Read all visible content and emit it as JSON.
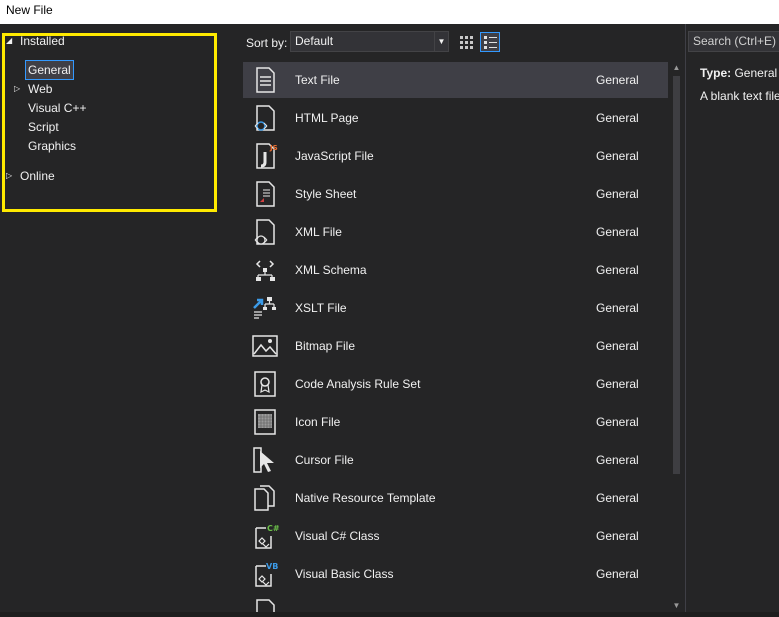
{
  "window": {
    "title": "New File"
  },
  "tree": {
    "installed": "Installed",
    "items": [
      {
        "label": "General",
        "selected": true,
        "expandable": false
      },
      {
        "label": "Web",
        "selected": false,
        "expandable": true
      },
      {
        "label": "Visual C++",
        "selected": false,
        "expandable": false
      },
      {
        "label": "Script",
        "selected": false,
        "expandable": false
      },
      {
        "label": "Graphics",
        "selected": false,
        "expandable": false
      }
    ],
    "online": "Online"
  },
  "toolbar": {
    "sort_label": "Sort by:",
    "sort_value": "Default"
  },
  "search": {
    "placeholder": "Search (Ctrl+E)"
  },
  "templates": [
    {
      "name": "Text File",
      "category": "General",
      "icon": "text-file-icon"
    },
    {
      "name": "HTML Page",
      "category": "General",
      "icon": "html-page-icon"
    },
    {
      "name": "JavaScript File",
      "category": "General",
      "icon": "javascript-file-icon"
    },
    {
      "name": "Style Sheet",
      "category": "General",
      "icon": "style-sheet-icon"
    },
    {
      "name": "XML File",
      "category": "General",
      "icon": "xml-file-icon"
    },
    {
      "name": "XML Schema",
      "category": "General",
      "icon": "xml-schema-icon"
    },
    {
      "name": "XSLT File",
      "category": "General",
      "icon": "xslt-file-icon"
    },
    {
      "name": "Bitmap File",
      "category": "General",
      "icon": "bitmap-file-icon"
    },
    {
      "name": "Code Analysis Rule Set",
      "category": "General",
      "icon": "rule-set-icon"
    },
    {
      "name": "Icon File",
      "category": "General",
      "icon": "icon-file-icon"
    },
    {
      "name": "Cursor File",
      "category": "General",
      "icon": "cursor-file-icon"
    },
    {
      "name": "Native Resource Template",
      "category": "General",
      "icon": "resource-template-icon"
    },
    {
      "name": "Visual C# Class",
      "category": "General",
      "icon": "csharp-class-icon"
    },
    {
      "name": "Visual Basic Class",
      "category": "General",
      "icon": "vb-class-icon"
    }
  ],
  "details": {
    "type_label": "Type:",
    "type_value": "General",
    "description": "A blank text file"
  },
  "colors": {
    "accent": "#3399ff",
    "highlight": "#ffea00",
    "background": "#252526"
  }
}
